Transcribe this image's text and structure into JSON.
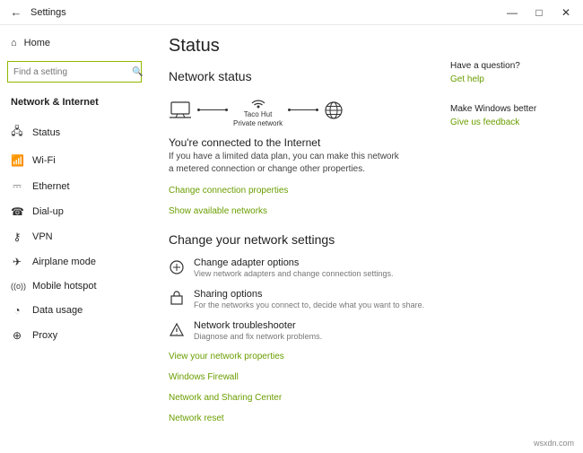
{
  "titlebar": {
    "back": "←",
    "title": "Settings",
    "min": "—",
    "max": "□",
    "close": "✕"
  },
  "sidebar": {
    "home": {
      "icon": "⌂",
      "label": "Home"
    },
    "search": {
      "placeholder": "Find a setting",
      "icon": "🔍"
    },
    "section": "Network & Internet",
    "items": [
      {
        "icon": "🖧",
        "label": "Status"
      },
      {
        "icon": "📶",
        "label": "Wi-Fi"
      },
      {
        "icon": "⎓",
        "label": "Ethernet"
      },
      {
        "icon": "☎",
        "label": "Dial-up"
      },
      {
        "icon": "⚷",
        "label": "VPN"
      },
      {
        "icon": "✈",
        "label": "Airplane mode"
      },
      {
        "icon": "((o))",
        "label": "Mobile hotspot"
      },
      {
        "icon": "◔",
        "label": "Data usage"
      },
      {
        "icon": "⊕",
        "label": "Proxy"
      }
    ]
  },
  "main": {
    "page_title": "Status",
    "net_status_hdr": "Network status",
    "router": {
      "name": "Taco Hut",
      "type": "Private network"
    },
    "connected_title": "You're connected to the Internet",
    "connected_desc": "If you have a limited data plan, you can make this network a metered connection or change other properties.",
    "link_change_props": "Change connection properties",
    "link_show_networks": "Show available networks",
    "change_settings_hdr": "Change your network settings",
    "rows": [
      {
        "title": "Change adapter options",
        "desc": "View network adapters and change connection settings."
      },
      {
        "title": "Sharing options",
        "desc": "For the networks you connect to, decide what you want to share."
      },
      {
        "title": "Network troubleshooter",
        "desc": "Diagnose and fix network problems."
      }
    ],
    "links": [
      "View your network properties",
      "Windows Firewall",
      "Network and Sharing Center",
      "Network reset"
    ]
  },
  "right": {
    "q1": "Have a question?",
    "l1": "Get help",
    "q2": "Make Windows better",
    "l2": "Give us feedback"
  },
  "watermark": "wsxdn.com"
}
